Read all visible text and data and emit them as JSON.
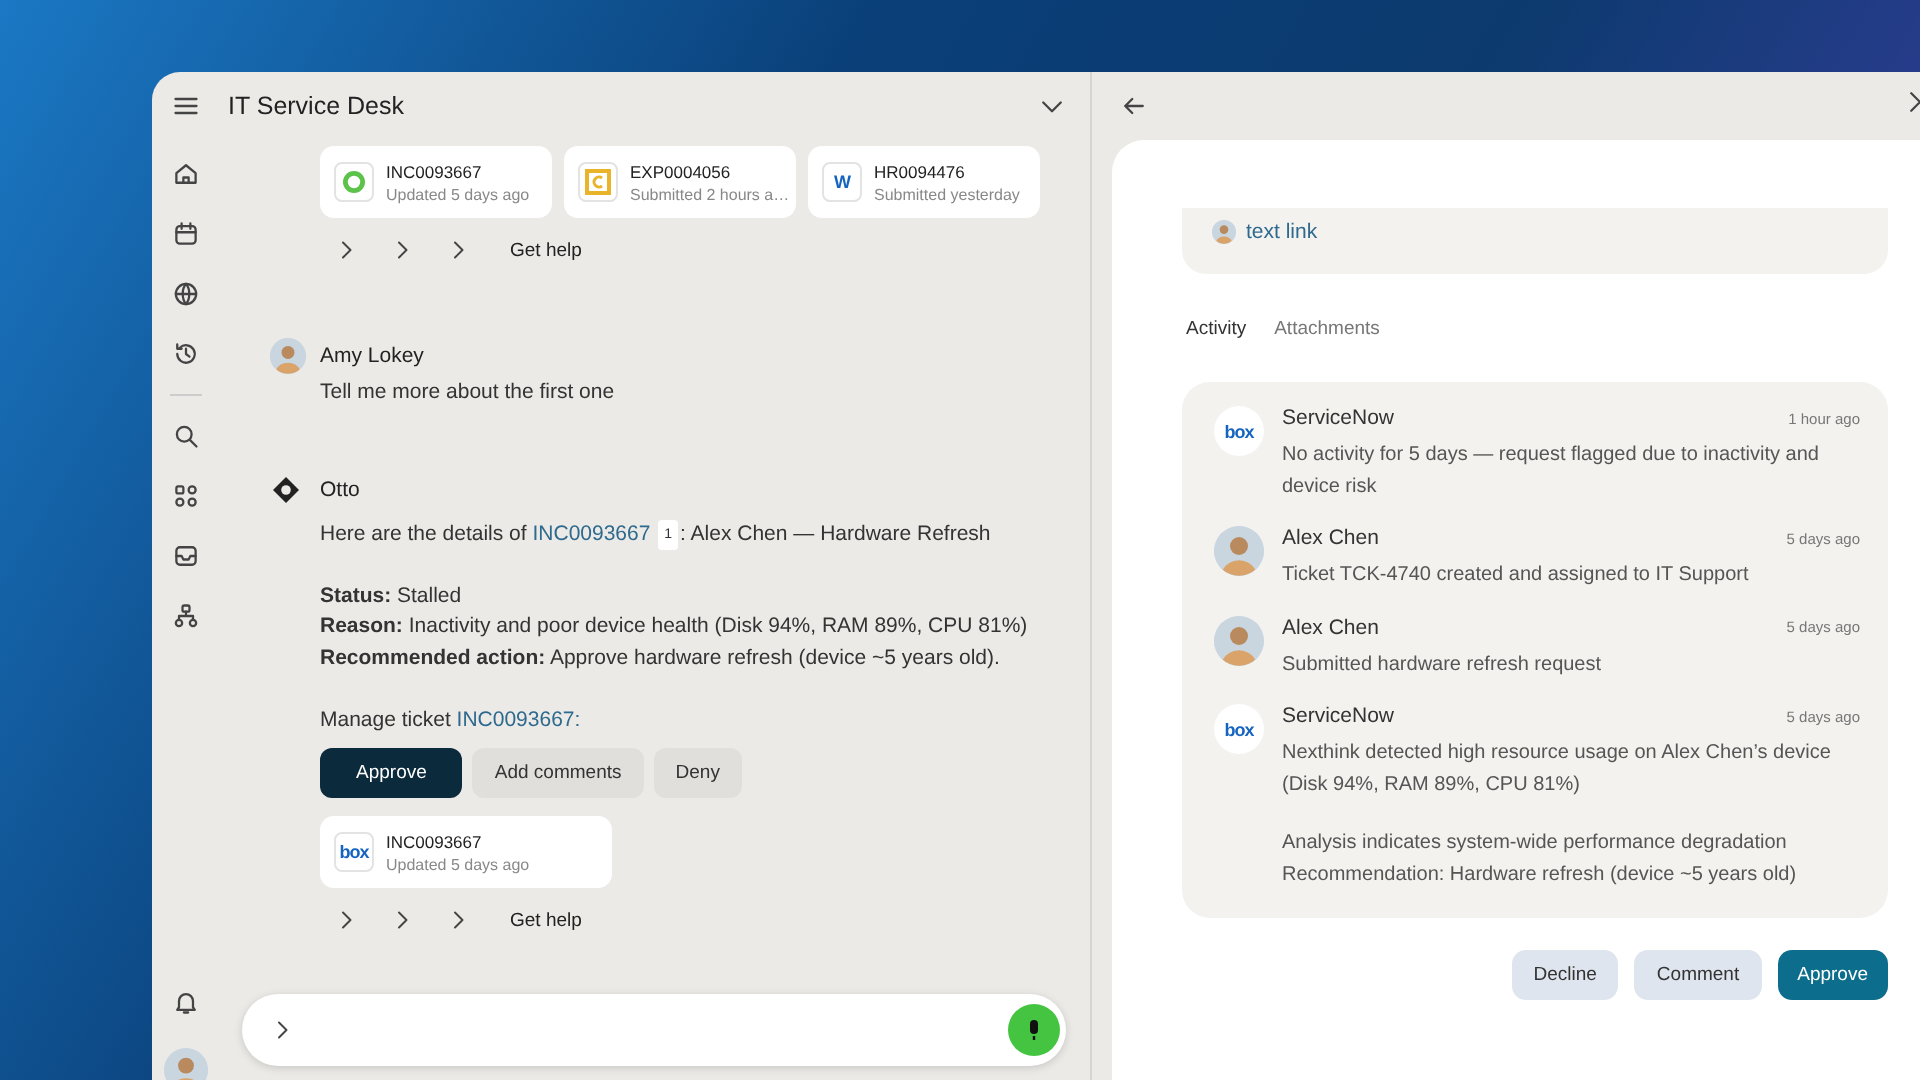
{
  "header": {
    "title": "IT Service Desk"
  },
  "top_tickets": [
    {
      "kind": "ring",
      "id": "INC0093667",
      "subtitle": "Updated 5 days ago"
    },
    {
      "kind": "c-square",
      "id": "EXP0004056",
      "subtitle": "Submitted 2 hours a…"
    },
    {
      "kind": "letter",
      "logo_text": "W",
      "id": "HR0094476",
      "subtitle": "Submitted yesterday"
    }
  ],
  "top_suggestions": {
    "label": "Get help"
  },
  "user_message": {
    "author": "Amy Lokey",
    "text": "Tell me more about the first one"
  },
  "bot_message": {
    "author": "Otto",
    "intro_prefix": "Here are the details of ",
    "intro_link": "INC0093667",
    "citation": "1",
    "intro_suffix": ": Alex Chen — Hardware Refresh",
    "fields": [
      "**Status:** Stalled",
      "**Reason:** Inactivity and poor device health (Disk 94%, RAM 89%, CPU 81%)",
      "**Recommended action:** Approve hardware refresh (device ~5 years old)."
    ],
    "manage_prefix": "Manage ticket ",
    "manage_link": "INC0093667:",
    "actions": [
      {
        "label": "Approve",
        "kind": "primary"
      },
      {
        "label": "Add comments",
        "kind": "secondary"
      },
      {
        "label": "Deny",
        "kind": "secondary"
      }
    ],
    "ticket": {
      "kind": "letter",
      "logo_text": "box",
      "id": "INC0093667",
      "subtitle": "Updated 5 days ago"
    }
  },
  "bottom_suggestions": {
    "label": "Get help"
  },
  "detail": {
    "link": "text link",
    "tabs": [
      {
        "label": "Activity",
        "selected": true
      },
      {
        "label": "Attachments",
        "selected": false
      }
    ],
    "activity": [
      {
        "kind": "system",
        "logo_text": "box",
        "author": "ServiceNow",
        "time": "1 hour ago",
        "paragraphs": [
          "No activity for 5 days — request flagged due to inactivity and device risk"
        ]
      },
      {
        "kind": "person",
        "author": "Alex Chen",
        "time": "5 days ago",
        "paragraphs": [
          "Ticket TCK-4740 created and assigned to IT Support"
        ]
      },
      {
        "kind": "person",
        "author": "Alex Chen",
        "time": "5 days ago",
        "paragraphs": [
          "Submitted hardware refresh request"
        ]
      },
      {
        "kind": "system",
        "logo_text": "box",
        "author": "ServiceNow",
        "time": "5 days ago",
        "paragraphs": [
          "Nexthink detected high resource usage on Alex Chen’s device (Disk 94%, RAM 89%, CPU 81%)",
          "Analysis indicates system-wide performance degradation\nRecommendation: Hardware refresh (device ~5 years old)"
        ]
      }
    ],
    "actions": [
      {
        "label": "Decline",
        "kind": "secondary"
      },
      {
        "label": "Comment",
        "kind": "secondary"
      },
      {
        "label": "Approve",
        "kind": "primary"
      }
    ]
  }
}
